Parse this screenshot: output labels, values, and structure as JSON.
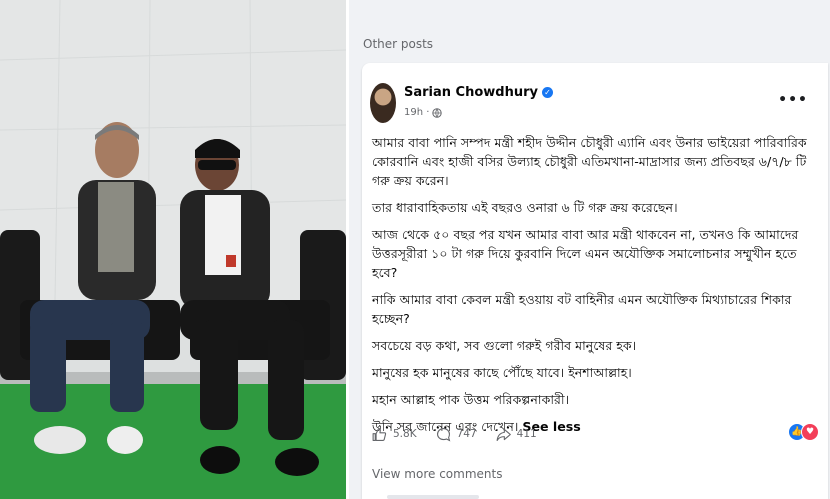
{
  "sidebar": {
    "heading": "Other posts"
  },
  "post": {
    "author": "Sarian Chowdhury",
    "time": "19h ·",
    "paragraphs": [
      "আমার বাবা পানি সম্পদ মন্ত্রী শহীদ উদ্দীন চৌধুরী এ্যানি এবং উনার ভাইয়েরা পারিবারিক কোরবানি এবং হাজী বসির উল্যাহ চৌধুরী এতিমখানা-মাদ্রাসার জন্য প্রতিবছর ৬/৭/৮ টি গরু ক্রয় করেন।",
      "তার ধারাবাহিকতায় এই বছরও ওনারা ৬ টি গরু ক্রয় করেছেন।",
      "আজ থেকে ৫০ বছর পর যখন আমার বাবা আর মন্ত্রী থাকবেন না, তখনও কি আমাদের উত্তরসূরীরা ১০ টা গরু দিয়ে কুরবানি দিলে এমন অযৌক্তিক সমালোচনার সম্মুখীন হতে হবে?",
      "নাকি আমার বাবা কেবল মন্ত্রী হওয়ায় বট বাহিনীর এমন অযৌক্তিক মিথ্যাচারের শিকার হচ্ছেন?",
      "সবচেয়ে বড় কথা, সব গুলো গরুই গরীব মানুষের হক।",
      "মানুষের হক মানুষের কাছে পৌঁছে যাবে। ইনশাআল্লাহ।",
      "মহান আল্লাহ পাক উত্তম পরিকল্পনাকারী।",
      "উনি সব জানেন এবং দেখেন।"
    ],
    "see_less": "See less",
    "likes": "5.8K",
    "comments": "747",
    "shares": "411",
    "view_more_comments": "View more comments"
  },
  "colors": {
    "accent": "#1877f2",
    "love": "#f33e58",
    "muted": "#65676b"
  },
  "icons": [
    "verified-icon",
    "globe-icon",
    "more-icon",
    "like-icon",
    "comment-icon",
    "share-icon",
    "like-reaction-icon",
    "love-reaction-icon"
  ]
}
